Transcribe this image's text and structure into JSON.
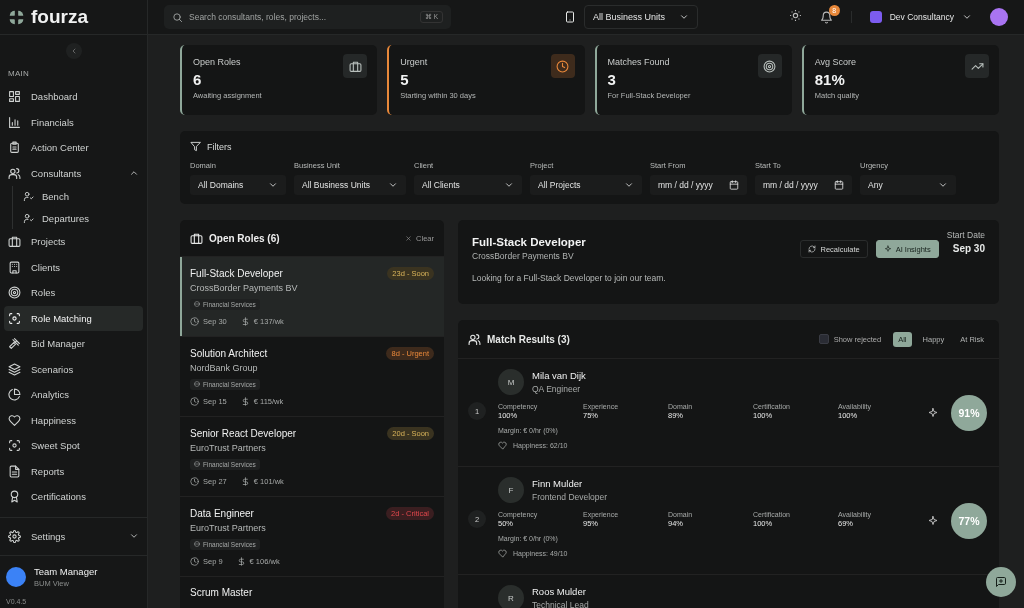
{
  "brand": {
    "name": "fourza"
  },
  "sidebar": {
    "section": "MAIN",
    "items": [
      {
        "label": "Dashboard",
        "selected": false
      },
      {
        "label": "Financials",
        "selected": false
      },
      {
        "label": "Action Center",
        "selected": false
      },
      {
        "label": "Consultants",
        "selected": false,
        "expanded": true,
        "children": [
          {
            "label": "Bench",
            "selected": false
          },
          {
            "label": "Departures",
            "selected": false
          }
        ]
      },
      {
        "label": "Projects",
        "selected": false
      },
      {
        "label": "Clients",
        "selected": false
      },
      {
        "label": "Roles",
        "selected": false
      },
      {
        "label": "Role Matching",
        "selected": true
      },
      {
        "label": "Bid Manager",
        "selected": false
      },
      {
        "label": "Scenarios",
        "selected": false
      },
      {
        "label": "Analytics",
        "selected": false
      },
      {
        "label": "Happiness",
        "selected": false
      },
      {
        "label": "Sweet Spot",
        "selected": false
      },
      {
        "label": "Reports",
        "selected": false
      },
      {
        "label": "Certifications",
        "selected": false
      }
    ],
    "settings": {
      "label": "Settings",
      "expanded": false
    },
    "user": {
      "name": "Team Manager",
      "role": "BUM View"
    },
    "version": "V0.4.5"
  },
  "topbar": {
    "search": {
      "placeholder": "Search consultants, roles, projects...",
      "shortcut": "⌘ K"
    },
    "business_unit": "All Business Units",
    "notifications": "8",
    "org": "Dev Consultancy"
  },
  "stats": [
    {
      "label": "Open Roles",
      "value": "6",
      "note": "Awaiting assignment",
      "color": "#8fa89a"
    },
    {
      "label": "Urgent",
      "value": "5",
      "note": "Starting within 30 days",
      "color": "#e8883a"
    },
    {
      "label": "Matches Found",
      "value": "3",
      "note": "For Full-Stack Developer",
      "color": "#8fa89a"
    },
    {
      "label": "Avg Score",
      "value": "81%",
      "note": "Match quality",
      "color": "#8fa89a"
    }
  ],
  "filters": {
    "title": "Filters",
    "fields": [
      {
        "label": "Domain",
        "value": "All Domains",
        "kind": "select"
      },
      {
        "label": "Business Unit",
        "value": "All Business Units",
        "kind": "select"
      },
      {
        "label": "Client",
        "value": "All Clients",
        "kind": "select"
      },
      {
        "label": "Project",
        "value": "All Projects",
        "kind": "select"
      },
      {
        "label": "Start From",
        "value": "mm / dd / yyyy",
        "kind": "date"
      },
      {
        "label": "Start To",
        "value": "mm / dd / yyyy",
        "kind": "date"
      },
      {
        "label": "Urgency",
        "value": "Any",
        "kind": "select"
      }
    ]
  },
  "open_roles": {
    "title": "Open Roles (6)",
    "clear": "Clear",
    "roles": [
      {
        "title": "Full-Stack Developer",
        "client": "CrossBorder Payments BV",
        "domain": "Financial Services",
        "date": "Sep 30",
        "rate": "€ 137/wk",
        "badge": "23d - Soon",
        "kind": "soon",
        "selected": true
      },
      {
        "title": "Solution Architect",
        "client": "NordBank Group",
        "domain": "Financial Services",
        "date": "Sep 15",
        "rate": "€ 115/wk",
        "badge": "8d - Urgent",
        "kind": "urgent",
        "selected": false
      },
      {
        "title": "Senior React Developer",
        "client": "EuroTrust Partners",
        "domain": "Financial Services",
        "date": "Sep 27",
        "rate": "€ 101/wk",
        "badge": "20d - Soon",
        "kind": "soon",
        "selected": false
      },
      {
        "title": "Data Engineer",
        "client": "EuroTrust Partners",
        "domain": "Financial Services",
        "date": "Sep 9",
        "rate": "€ 106/wk",
        "badge": "2d - Critical",
        "kind": "critical",
        "selected": false
      },
      {
        "title": "Scrum Master",
        "selected": false
      }
    ]
  },
  "role_detail": {
    "title": "Full-Stack Developer",
    "client": "CrossBorder Payments BV",
    "description": "Looking for a Full-Stack Developer to join our team.",
    "recalculate": "Recalculate",
    "insights": "AI Insights",
    "start_label": "Start Date",
    "start": "Sep 30"
  },
  "match_results": {
    "title": "Match Results (3)",
    "show_rejected": {
      "label": "Show rejected",
      "checked": false
    },
    "tabs": [
      {
        "label": "All",
        "selected": true
      },
      {
        "label": "Happy",
        "selected": false
      },
      {
        "label": "At Risk",
        "selected": false
      }
    ],
    "matches": [
      {
        "rank": "1",
        "initial": "M",
        "name": "Mila van Dijk",
        "role": "QA Engineer",
        "metrics": [
          {
            "label": "Competency",
            "value": "100%"
          },
          {
            "label": "Experience",
            "value": "75%"
          },
          {
            "label": "Domain",
            "value": "89%"
          },
          {
            "label": "Certification",
            "value": "100%"
          },
          {
            "label": "Availability",
            "value": "100%"
          }
        ],
        "margin": "Margin: € 0/hr (0%)",
        "happiness": "Happiness: 62/10",
        "score": "91%"
      },
      {
        "rank": "2",
        "initial": "F",
        "name": "Finn Mulder",
        "role": "Frontend Developer",
        "metrics": [
          {
            "label": "Competency",
            "value": "50%"
          },
          {
            "label": "Experience",
            "value": "95%"
          },
          {
            "label": "Domain",
            "value": "94%"
          },
          {
            "label": "Certification",
            "value": "100%"
          },
          {
            "label": "Availability",
            "value": "69%"
          }
        ],
        "margin": "Margin: € 0/hr (0%)",
        "happiness": "Happiness: 49/10",
        "score": "77%"
      },
      {
        "initial": "R",
        "name": "Roos Mulder",
        "role": "Technical Lead"
      }
    ]
  }
}
